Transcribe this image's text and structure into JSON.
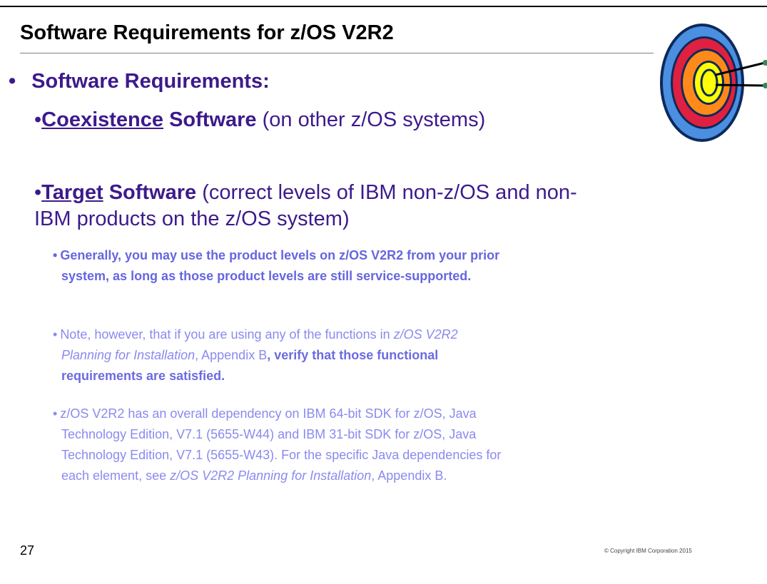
{
  "slide": {
    "title": "Software Requirements for z/OS V2R2",
    "heading_bullet": "•",
    "heading": "Software Requirements:",
    "coexistence": {
      "bullet": "•",
      "term": "Coexistence",
      "word": " Software",
      "rest": " (on other z/OS systems)"
    },
    "target": {
      "bullet": "•",
      "term": "Target",
      "word": " Software",
      "rest_line1": " (correct levels of IBM non-z/OS and non-",
      "rest_line2": "IBM products on the z/OS system)"
    },
    "sub1": {
      "bullet": "•",
      "line1": "Generally, you may use the product levels on z/OS V2R2 from your prior",
      "line2": "system, as long as those product levels are still service-supported."
    },
    "sub2": {
      "bullet": "•",
      "line1_text": "Note, however, that if you are using any of the functions in ",
      "line1_italic": "z/OS V2R2",
      "line2_italic": "Planning for Installation",
      "line2_text": ", Appendix B",
      "line2_bold": ", verify that those functional",
      "line3_bold": "requirements are satisfied."
    },
    "sub3": {
      "bullet": "•",
      "line1": "z/OS V2R2 has an overall dependency on IBM 64-bit SDK for z/OS, Java",
      "line2": "Technology Edition, V7.1 (5655-W44) and IBM 31-bit SDK for z/OS, Java",
      "line3": "Technology Edition, V7.1 (5655-W43). For the specific Java dependencies for",
      "line4_text": "each element, see ",
      "line4_italic": "z/OS V2R2 Planning for Installation",
      "line4_end": ", Appendix B."
    },
    "page_number": "27",
    "copyright": "© Copyright IBM Corporation 2015"
  },
  "colors": {
    "heading": "#3d1a8c",
    "bold_sub": "#6666e0",
    "light_sub": "#8a8af0"
  },
  "graphic": {
    "icon": "target-icon"
  }
}
